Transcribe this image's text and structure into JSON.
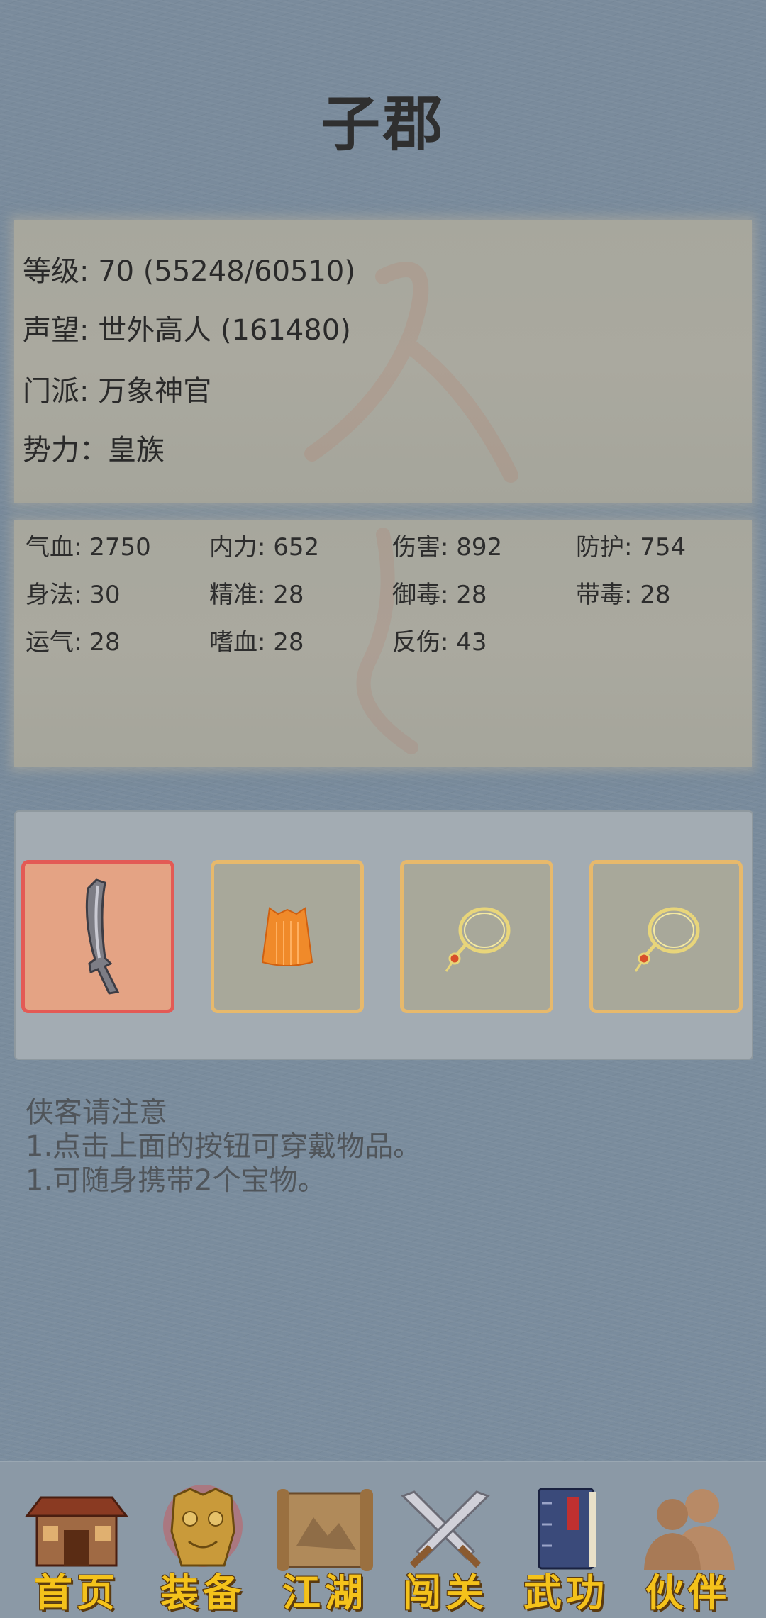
{
  "character": {
    "name": "子郡"
  },
  "info": {
    "level": "等级: 70 (55248/60510)",
    "prestige": "声望: 世外高人 (161480)",
    "sect": "门派: 万象神官",
    "faction": "势力：皇族"
  },
  "stats": [
    {
      "label": "气血: 2750"
    },
    {
      "label": "内力: 652"
    },
    {
      "label": "伤害: 892"
    },
    {
      "label": "防护: 754"
    },
    {
      "label": "身法: 30"
    },
    {
      "label": "精准: 28"
    },
    {
      "label": "御毒: 28"
    },
    {
      "label": "带毒: 28"
    },
    {
      "label": "运气: 28"
    },
    {
      "label": "嗜血: 28"
    },
    {
      "label": "反伤: 43"
    }
  ],
  "equipment": {
    "slots": [
      {
        "icon": "sword-icon",
        "selected": true
      },
      {
        "icon": "robe-icon",
        "selected": false
      },
      {
        "icon": "necklace-icon",
        "selected": false
      },
      {
        "icon": "necklace-icon",
        "selected": false
      }
    ]
  },
  "notes": {
    "title": "侠客请注意",
    "line1": "1.点击上面的按钮可穿戴物品。",
    "line2": "1.可随身携带2个宝物。"
  },
  "nav": {
    "items": [
      {
        "label": "首页",
        "icon": "house-icon"
      },
      {
        "label": "装备",
        "icon": "armor-icon",
        "active": true
      },
      {
        "label": "江湖",
        "icon": "scroll-map-icon"
      },
      {
        "label": "闯关",
        "icon": "crossed-swords-icon"
      },
      {
        "label": "武功",
        "icon": "book-icon"
      },
      {
        "label": "伙伴",
        "icon": "partners-icon"
      }
    ]
  },
  "colors": {
    "accent_gold": "#f4c21b",
    "selected_slot_border": "#e35a55",
    "slot_border": "#e7b96c"
  }
}
